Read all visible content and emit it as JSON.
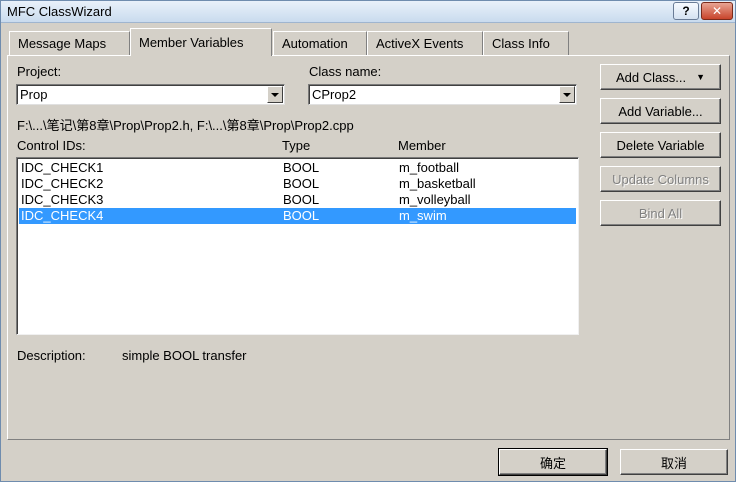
{
  "window": {
    "title": "MFC ClassWizard",
    "help_label": "?",
    "close_label": "✕"
  },
  "tabs": [
    {
      "label": "Message Maps"
    },
    {
      "label": "Member Variables"
    },
    {
      "label": "Automation"
    },
    {
      "label": "ActiveX Events"
    },
    {
      "label": "Class Info"
    }
  ],
  "project": {
    "label": "Project:",
    "value": "Prop"
  },
  "class_name": {
    "label": "Class name:",
    "value": "CProp2"
  },
  "file_path": "F:\\...\\笔记\\第8章\\Prop\\Prop2.h, F:\\...\\第8章\\Prop\\Prop2.cpp",
  "list": {
    "headers": [
      "Control IDs:",
      "Type",
      "Member"
    ],
    "rows": [
      {
        "id": "IDC_CHECK1",
        "type": "BOOL",
        "member": "m_football"
      },
      {
        "id": "IDC_CHECK2",
        "type": "BOOL",
        "member": "m_basketball"
      },
      {
        "id": "IDC_CHECK3",
        "type": "BOOL",
        "member": "m_volleyball"
      },
      {
        "id": "IDC_CHECK4",
        "type": "BOOL",
        "member": "m_swim"
      }
    ],
    "selected_index": 3
  },
  "description": {
    "label": "Description:",
    "value": "simple BOOL transfer"
  },
  "side_buttons": {
    "add_class": "Add Class...",
    "add_variable": "Add Variable...",
    "delete_variable": "Delete Variable",
    "update_columns": "Update Columns",
    "bind_all": "Bind All"
  },
  "footer": {
    "ok": "确定",
    "cancel": "取消"
  },
  "colors": {
    "selection": "#3399ff",
    "dialog_bg": "#d4d0c8"
  }
}
